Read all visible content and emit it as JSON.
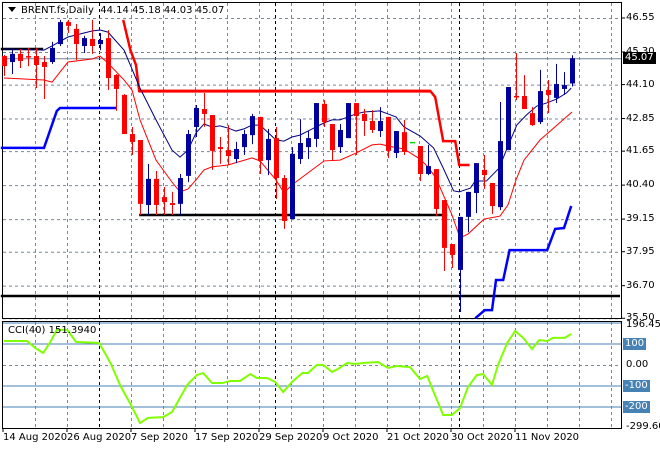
{
  "header": {
    "symbol": "BRENT.fs,Daily",
    "ohlc": "44.14 45.18 44.03 45.07"
  },
  "cci_header": {
    "label": "CCI(40) 151.3940"
  },
  "current_price": "45.07",
  "colors": {
    "bull": "#0000a0",
    "bear": "#ff0000",
    "doji": "#00e000",
    "ma_fast": "#000080",
    "ma_slow": "#ff0000",
    "upper_channel": "#ff0000",
    "lower_channel": "#0000ff",
    "cci": "#80ff00",
    "level": "#4682b4"
  },
  "chart_data": [
    {
      "type": "candlestick",
      "title": "BRENT.fs,Daily",
      "ylim": [
        35.5,
        46.55
      ],
      "y_ticks": [
        "46.55",
        "45.30",
        "44.10",
        "42.85",
        "41.65",
        "40.40",
        "39.15",
        "37.95",
        "36.70",
        "35.50"
      ],
      "y_tick_values": [
        46.55,
        45.3,
        44.1,
        42.85,
        41.65,
        40.4,
        39.15,
        37.95,
        36.7,
        35.5
      ],
      "x_labels": [
        {
          "index": 0,
          "text": "14 Aug 2020"
        },
        {
          "index": 8,
          "text": "26 Aug 2020"
        },
        {
          "index": 16,
          "text": "7 Sep 2020"
        },
        {
          "index": 24,
          "text": "17 Sep 2020"
        },
        {
          "index": 32,
          "text": "29 Sep 2020"
        },
        {
          "index": 40,
          "text": "9 Oct 2020"
        },
        {
          "index": 48,
          "text": "21 Oct 2020"
        },
        {
          "index": 56,
          "text": "30 Oct 2020"
        },
        {
          "index": 64,
          "text": "11 Nov 2020"
        }
      ],
      "ohlc": [
        [
          45.15,
          45.19,
          44.42,
          44.78
        ],
        [
          44.93,
          45.37,
          44.49,
          45.23
        ],
        [
          45.23,
          45.41,
          44.71,
          44.97
        ],
        [
          45.15,
          45.45,
          44.78,
          45.11
        ],
        [
          45.15,
          45.45,
          43.97,
          44.82
        ],
        [
          44.93,
          45.15,
          43.57,
          44.75
        ],
        [
          44.93,
          45.67,
          44.86,
          45.45
        ],
        [
          45.59,
          46.48,
          45.52,
          46.4
        ],
        [
          46.4,
          46.48,
          46.0,
          46.26
        ],
        [
          46.15,
          46.33,
          45.0,
          45.59
        ],
        [
          45.52,
          45.89,
          45.26,
          45.81
        ],
        [
          45.78,
          46.48,
          45.23,
          45.52
        ],
        [
          45.59,
          46.0,
          45.37,
          45.74
        ],
        [
          45.81,
          46.11,
          43.9,
          44.34
        ],
        [
          44.45,
          44.49,
          43.13,
          43.94
        ],
        [
          43.72,
          43.75,
          42.28,
          42.28
        ],
        [
          42.28,
          42.54,
          41.51,
          41.99
        ],
        [
          42.06,
          42.06,
          39.3,
          39.71
        ],
        [
          39.67,
          41.18,
          39.3,
          40.63
        ],
        [
          40.63,
          40.92,
          39.3,
          39.67
        ],
        [
          39.96,
          40.33,
          39.3,
          39.78
        ],
        [
          39.74,
          40.15,
          39.3,
          39.67
        ],
        [
          39.71,
          40.81,
          39.3,
          40.66
        ],
        [
          40.74,
          42.43,
          40.51,
          42.28
        ],
        [
          42.54,
          43.35,
          42.17,
          43.24
        ],
        [
          43.2,
          43.79,
          42.54,
          43.02
        ],
        [
          42.98,
          42.98,
          40.96,
          41.66
        ],
        [
          41.8,
          42.17,
          41.18,
          41.73
        ],
        [
          41.69,
          42.61,
          41.14,
          41.47
        ],
        [
          41.36,
          41.99,
          41.21,
          41.73
        ],
        [
          41.8,
          42.43,
          41.51,
          42.28
        ],
        [
          42.24,
          43.02,
          41.91,
          42.94
        ],
        [
          42.91,
          42.91,
          40.81,
          41.29
        ],
        [
          41.32,
          42.47,
          40.77,
          42.1
        ],
        [
          42.13,
          42.54,
          39.89,
          40.66
        ],
        [
          40.66,
          40.77,
          38.79,
          39.08
        ],
        [
          39.15,
          41.8,
          39.15,
          41.55
        ],
        [
          41.36,
          42.83,
          41.18,
          41.95
        ],
        [
          41.8,
          42.39,
          41.36,
          42.13
        ],
        [
          42.1,
          43.42,
          41.8,
          43.42
        ],
        [
          43.39,
          43.53,
          42.54,
          42.72
        ],
        [
          42.65,
          42.65,
          41.29,
          41.69
        ],
        [
          41.8,
          42.65,
          41.58,
          42.43
        ],
        [
          42.13,
          43.42,
          42.13,
          43.42
        ],
        [
          43.42,
          43.42,
          41.51,
          42.94
        ],
        [
          43.02,
          43.2,
          42.21,
          42.76
        ],
        [
          42.76,
          43.16,
          42.32,
          42.43
        ],
        [
          42.39,
          43.27,
          42.17,
          42.76
        ],
        [
          42.91,
          42.91,
          41.4,
          41.66
        ],
        [
          41.58,
          42.39,
          41.4,
          42.39
        ],
        [
          42.35,
          42.8,
          41.51,
          41.62
        ],
        [
          41.99,
          41.99,
          41.99,
          41.99
        ],
        [
          41.84,
          41.84,
          40.55,
          40.81
        ],
        [
          40.81,
          41.88,
          40.77,
          41.1
        ],
        [
          40.99,
          40.99,
          39.26,
          39.52
        ],
        [
          39.85,
          39.85,
          37.24,
          38.09
        ],
        [
          38.23,
          38.23,
          37.35,
          37.83
        ],
        [
          37.28,
          39.23,
          35.73,
          39.23
        ],
        [
          39.23,
          40.15,
          38.67,
          40.15
        ],
        [
          40.11,
          41.21,
          39.37,
          41.21
        ],
        [
          40.96,
          41.51,
          40.26,
          40.77
        ],
        [
          40.48,
          40.48,
          39.34,
          39.63
        ],
        [
          39.59,
          43.46,
          39.48,
          42.02
        ],
        [
          41.69,
          44.01,
          41.69,
          44.01
        ],
        [
          43.68,
          45.26,
          43.53,
          43.64
        ],
        [
          43.68,
          44.45,
          43.2,
          43.2
        ],
        [
          43.05,
          43.27,
          42.58,
          42.61
        ],
        [
          42.72,
          44.64,
          42.65,
          43.86
        ],
        [
          43.9,
          44.27,
          43.05,
          43.72
        ],
        [
          43.61,
          44.86,
          43.42,
          44.12
        ],
        [
          43.94,
          44.56,
          43.72,
          44.08
        ],
        [
          44.14,
          45.18,
          44.03,
          45.07
        ]
      ],
      "ma_fast": [
        [
          0,
          45.41
        ],
        [
          5,
          45.37
        ],
        [
          6,
          45.52
        ],
        [
          8,
          45.85
        ],
        [
          11,
          46.07
        ],
        [
          12,
          46.11
        ],
        [
          13,
          46.03
        ],
        [
          15,
          45.37
        ],
        [
          17,
          43.97
        ],
        [
          19,
          42.8
        ],
        [
          21,
          41.69
        ],
        [
          22,
          41.43
        ],
        [
          23,
          41.69
        ],
        [
          24,
          42.32
        ],
        [
          25,
          42.65
        ],
        [
          26,
          42.54
        ],
        [
          27,
          42.58
        ],
        [
          28,
          42.5
        ],
        [
          29,
          42.39
        ],
        [
          30,
          42.47
        ],
        [
          31,
          42.61
        ],
        [
          32,
          42.61
        ],
        [
          34,
          42.06
        ],
        [
          35,
          42.02
        ],
        [
          36,
          42.17
        ],
        [
          37,
          42.24
        ],
        [
          38,
          42.39
        ],
        [
          39,
          42.54
        ],
        [
          40,
          42.69
        ],
        [
          41,
          42.8
        ],
        [
          42,
          42.8
        ],
        [
          43,
          42.91
        ],
        [
          44,
          43.02
        ],
        [
          45,
          43.09
        ],
        [
          47,
          43.13
        ],
        [
          48,
          43.02
        ],
        [
          49,
          42.91
        ],
        [
          50,
          42.54
        ],
        [
          52,
          42.21
        ],
        [
          53.7,
          41.77
        ],
        [
          54.9,
          41.03
        ],
        [
          56.2,
          40.19
        ],
        [
          56.9,
          40.15
        ],
        [
          58.3,
          40.29
        ],
        [
          58.9,
          40.55
        ],
        [
          60.3,
          40.55
        ],
        [
          61.9,
          41.03
        ],
        [
          62.9,
          41.77
        ],
        [
          64.1,
          42.61
        ],
        [
          65.3,
          42.98
        ],
        [
          66.6,
          43.31
        ],
        [
          67.8,
          43.42
        ],
        [
          69.1,
          43.57
        ],
        [
          70.3,
          43.79
        ],
        [
          70.9,
          43.97
        ]
      ],
      "ma_slow": [
        [
          0,
          44.34
        ],
        [
          5,
          44.27
        ],
        [
          6,
          44.19
        ],
        [
          8,
          44.93
        ],
        [
          11,
          45.04
        ],
        [
          12,
          45.15
        ],
        [
          13,
          44.89
        ],
        [
          15,
          44.27
        ],
        [
          16,
          43.9
        ],
        [
          17,
          42.8
        ],
        [
          19,
          41.32
        ],
        [
          21,
          40.51
        ],
        [
          22,
          40.15
        ],
        [
          23,
          40.26
        ],
        [
          24,
          40.59
        ],
        [
          25,
          40.96
        ],
        [
          26,
          41.07
        ],
        [
          28,
          41.14
        ],
        [
          31,
          41.4
        ],
        [
          32,
          41.29
        ],
        [
          34,
          40.59
        ],
        [
          35,
          40.11
        ],
        [
          36,
          40.41
        ],
        [
          38,
          40.85
        ],
        [
          40,
          41.29
        ],
        [
          42,
          41.32
        ],
        [
          44,
          41.58
        ],
        [
          46,
          41.88
        ],
        [
          47,
          41.91
        ],
        [
          48,
          41.84
        ],
        [
          50,
          41.73
        ],
        [
          52,
          41.36
        ],
        [
          53,
          41.07
        ],
        [
          54,
          40.66
        ],
        [
          56,
          39.3
        ],
        [
          57,
          38.46
        ],
        [
          58,
          38.6
        ],
        [
          60,
          39.15
        ],
        [
          62,
          39.26
        ],
        [
          63,
          39.67
        ],
        [
          64,
          40.59
        ],
        [
          65,
          41.32
        ],
        [
          67,
          42.06
        ],
        [
          71,
          43.09
        ]
      ],
      "upper_channel": [
        [
          14.9,
          46.48
        ],
        [
          15.8,
          45.37
        ],
        [
          16.5,
          44.82
        ],
        [
          16.9,
          43.86
        ],
        [
          53.3,
          43.86
        ],
        [
          53.9,
          43.64
        ],
        [
          54.9,
          42.02
        ],
        [
          56.4,
          42.02
        ],
        [
          56.9,
          41.14
        ],
        [
          58.2,
          41.14
        ]
      ],
      "lower_channel_a": [
        [
          -0.4,
          41.77
        ],
        [
          5,
          41.77
        ],
        [
          6.6,
          43.13
        ],
        [
          7,
          43.24
        ],
        [
          14,
          43.24
        ]
      ],
      "lower_channel_b": [
        [
          58.9,
          35.5
        ],
        [
          60.1,
          35.8
        ],
        [
          61,
          35.8
        ],
        [
          61.5,
          36.91
        ],
        [
          62.4,
          36.91
        ],
        [
          63.2,
          38.01
        ],
        [
          67.9,
          38.01
        ],
        [
          68.9,
          38.79
        ],
        [
          70,
          38.82
        ],
        [
          70.9,
          39.63
        ]
      ],
      "horizontal_lines": [
        {
          "price": 45.41,
          "from": -0.4,
          "to": 4.9
        },
        {
          "price": 43.86,
          "from": 16.9,
          "to": 53.3,
          "color": "red"
        },
        {
          "price": 39.3,
          "from": 16.9,
          "to": 55.4
        },
        {
          "price": 36.32,
          "from": -0.4,
          "to": 77
        }
      ]
    },
    {
      "type": "line",
      "title": "CCI(40) 151.3940",
      "ylim": [
        -299.603,
        196.4581
      ],
      "levels": [
        100,
        0,
        -100,
        -200
      ],
      "level_labels": [
        "100",
        "0.00",
        "-100",
        "-200"
      ],
      "max_label": "196.4581",
      "min_label": "-299.603",
      "points": [
        [
          0,
          114
        ],
        [
          2.9,
          114
        ],
        [
          3.9,
          81
        ],
        [
          4.9,
          57
        ],
        [
          5.8,
          110
        ],
        [
          6.6,
          167
        ],
        [
          7.9,
          167
        ],
        [
          9,
          110
        ],
        [
          11.9,
          105
        ],
        [
          13.3,
          10
        ],
        [
          14.5,
          -95
        ],
        [
          16,
          -200
        ],
        [
          17,
          -276
        ],
        [
          18,
          -252
        ],
        [
          19.9,
          -248
        ],
        [
          21,
          -224
        ],
        [
          22.9,
          -95
        ],
        [
          24.1,
          -48
        ],
        [
          24.9,
          -38
        ],
        [
          26,
          -86
        ],
        [
          27.3,
          -86
        ],
        [
          28.3,
          -76
        ],
        [
          29.5,
          -76
        ],
        [
          30.8,
          -43
        ],
        [
          31.6,
          -62
        ],
        [
          32.9,
          -62
        ],
        [
          33.9,
          -81
        ],
        [
          34.9,
          -129
        ],
        [
          36,
          -81
        ],
        [
          37.3,
          -38
        ],
        [
          38,
          -38
        ],
        [
          39.1,
          0
        ],
        [
          39.9,
          0
        ],
        [
          41,
          -33
        ],
        [
          41.75,
          -19
        ],
        [
          42.9,
          10
        ],
        [
          43.9,
          5
        ],
        [
          45.1,
          10
        ],
        [
          46.75,
          14
        ],
        [
          48,
          -14
        ],
        [
          49.1,
          -5
        ],
        [
          50.75,
          -10
        ],
        [
          52,
          -67
        ],
        [
          52.9,
          -52
        ],
        [
          53.6,
          -119
        ],
        [
          54.9,
          -238
        ],
        [
          56,
          -238
        ],
        [
          57,
          -205
        ],
        [
          58,
          -105
        ],
        [
          59.1,
          -48
        ],
        [
          59.9,
          -43
        ],
        [
          61,
          -95
        ],
        [
          61.75,
          0
        ],
        [
          62.9,
          105
        ],
        [
          63.9,
          162
        ],
        [
          64.9,
          129
        ],
        [
          66,
          76
        ],
        [
          66.9,
          119
        ],
        [
          67.9,
          114
        ],
        [
          68.6,
          129
        ],
        [
          70.1,
          129
        ],
        [
          70.9,
          148
        ]
      ]
    }
  ]
}
